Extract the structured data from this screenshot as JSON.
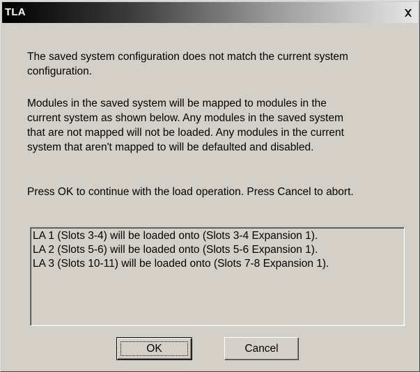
{
  "window": {
    "title": "TLA",
    "close_icon": "close-icon"
  },
  "message": {
    "paragraph1": "The saved system configuration does not match the current system\nconfiguration.",
    "paragraph2": "Modules in the saved system will be mapped to modules in the\ncurrent system as shown below. Any modules in the saved system\nthat are not mapped will not be loaded. Any modules in the current\nsystem that aren't mapped to will be defaulted and disabled.",
    "paragraph3": "Press OK to continue with the load operation. Press Cancel to abort."
  },
  "mapping_list": [
    "LA 1 (Slots 3-4) will be loaded onto  (Slots 3-4 Expansion 1).",
    "LA 2 (Slots 5-6) will be loaded onto  (Slots 5-6 Expansion 1).",
    "LA 3 (Slots 10-11) will be loaded onto  (Slots 7-8 Expansion 1)."
  ],
  "buttons": {
    "ok_label": "OK",
    "cancel_label": "Cancel"
  }
}
